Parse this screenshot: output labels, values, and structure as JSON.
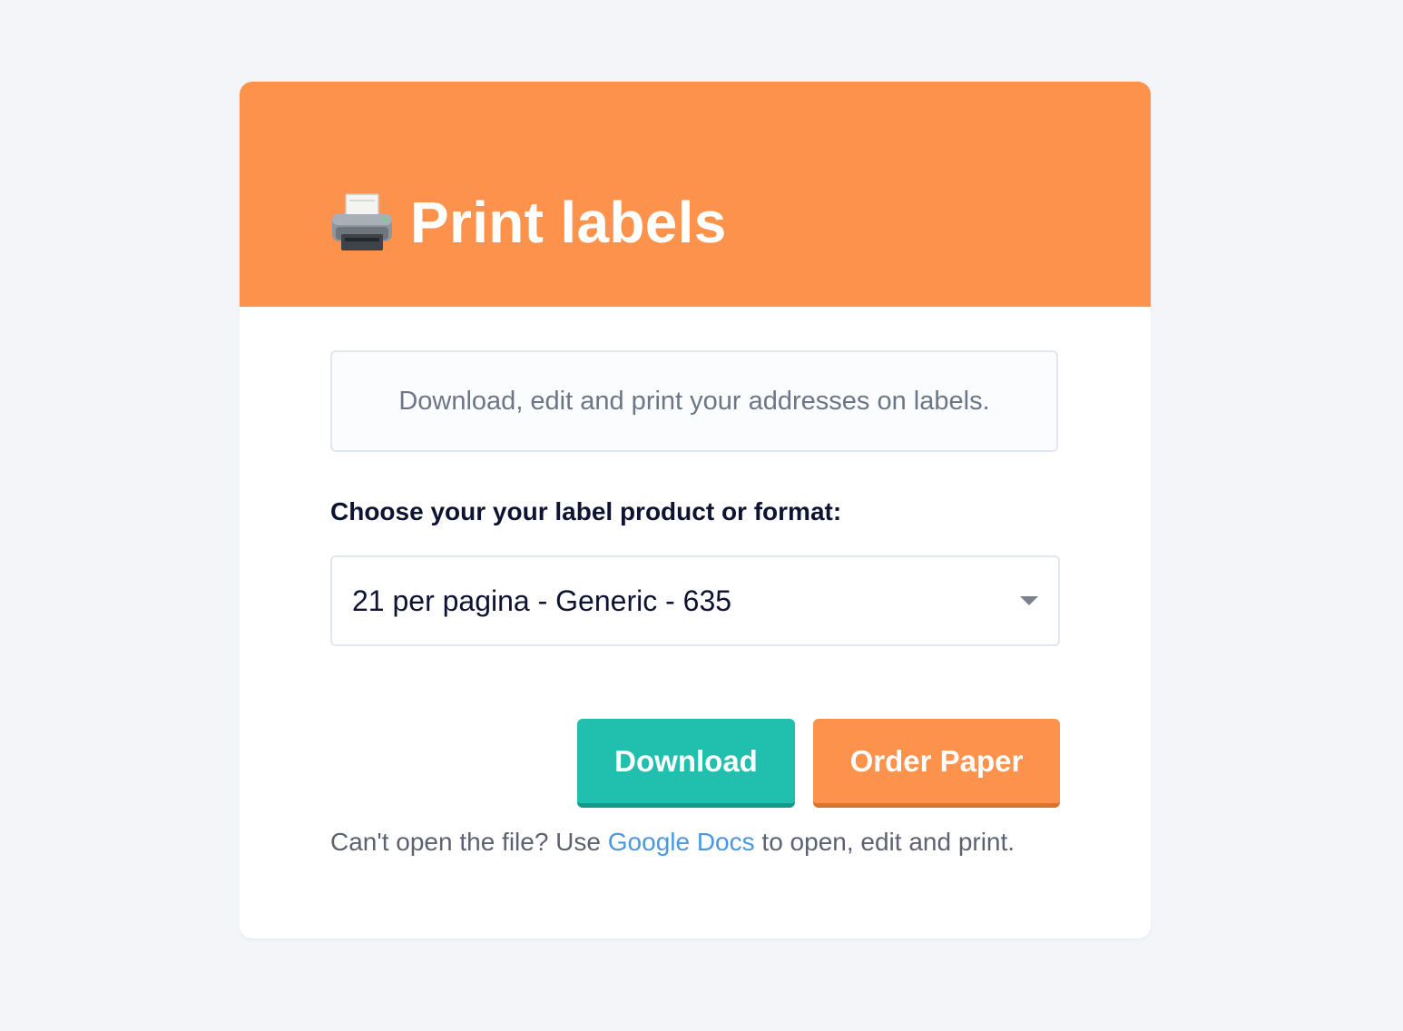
{
  "header": {
    "title": "Print labels",
    "icon": "printer-icon",
    "background_color": "#fc924b"
  },
  "info": {
    "text": "Download, edit and print your addresses on labels."
  },
  "format": {
    "label": "Choose your your label product or format:",
    "selected": "21 per pagina - Generic - 635"
  },
  "actions": {
    "download_label": "Download",
    "download_color": "#21bfae",
    "order_label": "Order Paper",
    "order_color": "#fc924b"
  },
  "help": {
    "prefix": "Can't open the file? Use ",
    "link_text": "Google Docs",
    "suffix": " to open, edit and print.",
    "link_color": "#4b97e0"
  }
}
